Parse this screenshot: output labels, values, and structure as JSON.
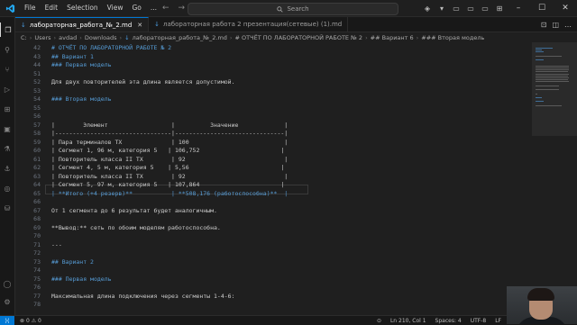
{
  "titlebar": {
    "menu": [
      "File",
      "Edit",
      "Selection",
      "View",
      "Go",
      "..."
    ],
    "search_placeholder": "Search"
  },
  "tabs": [
    {
      "label": "лабораторная_работа_№_2.md",
      "active": true
    },
    {
      "label": "лабораторная работа 2 презентация(сетевые) (1).md",
      "active": false
    }
  ],
  "breadcrumb": [
    "C:",
    "Users",
    "avdad",
    "Downloads",
    "лабораторная_работа_№_2.md",
    "# ОТЧЁТ ПО ЛАБОРАТОРНОЙ РАБОТЕ № 2",
    "## Вариант 6",
    "### Вторая модель"
  ],
  "editor": {
    "lines": [
      {
        "n": "42",
        "text": "# ОТЧЁТ ПО ЛАБОРАТОРНОЙ РАБОТЕ № 2",
        "style": "heading"
      },
      {
        "n": "43",
        "text": "## Вариант 1",
        "style": "heading"
      },
      {
        "n": "44",
        "text": "### Первая модель",
        "style": "heading"
      },
      {
        "n": "51",
        "text": "",
        "style": ""
      },
      {
        "n": "52",
        "text": "Для двух повторителей эта длина является допустимой.",
        "style": ""
      },
      {
        "n": "53",
        "text": "",
        "style": ""
      },
      {
        "n": "54",
        "text": "### Вторая модель",
        "style": "heading"
      },
      {
        "n": "55",
        "text": "",
        "style": ""
      },
      {
        "n": "56",
        "text": "",
        "style": ""
      },
      {
        "n": "57",
        "text": "|        Элемент                  |          Значение             |",
        "style": ""
      },
      {
        "n": "58",
        "text": "|---------------------------------|-------------------------------|",
        "style": ""
      },
      {
        "n": "59",
        "text": "| Пара терминалов ТХ              | 100                           |",
        "style": ""
      },
      {
        "n": "60",
        "text": "| Сегмент 1, 96 м, категория 5   | 106,752                       |",
        "style": ""
      },
      {
        "n": "61",
        "text": "| Повторитель класса II TX        | 92                            |",
        "style": ""
      },
      {
        "n": "62",
        "text": "| Сегмент 4, 5 м, категория 5    | 5,56                          |",
        "style": ""
      },
      {
        "n": "63",
        "text": "| Повторитель класса II TX        | 92                            |",
        "style": ""
      },
      {
        "n": "64",
        "text": "| Сегмент 5, 97 м, категория 5   | 107,864                       |",
        "style": ""
      },
      {
        "n": "65",
        "text": "| **Итого (+4 резерв)**           | **508,176 (работоспособна)**  |",
        "style": "bold"
      },
      {
        "n": "66",
        "text": "",
        "style": ""
      },
      {
        "n": "67",
        "text": "От 1 сегмента до 6 результат будет аналогичным.",
        "style": ""
      },
      {
        "n": "68",
        "text": "",
        "style": ""
      },
      {
        "n": "69",
        "text": "**Вывод:** сеть по обоим моделям работоспособна.",
        "style": "mixed"
      },
      {
        "n": "70",
        "text": "",
        "style": ""
      },
      {
        "n": "71",
        "text": "---",
        "style": ""
      },
      {
        "n": "72",
        "text": "",
        "style": ""
      },
      {
        "n": "73",
        "text": "## Вариант 2",
        "style": "heading"
      },
      {
        "n": "74",
        "text": "",
        "style": ""
      },
      {
        "n": "75",
        "text": "### Первая модель",
        "style": "heading"
      },
      {
        "n": "76",
        "text": "",
        "style": ""
      },
      {
        "n": "77",
        "text": "Максимальная длина подключения через сегменты 1-4-6:",
        "style": ""
      },
      {
        "n": "78",
        "text": "",
        "style": ""
      }
    ]
  },
  "statusbar": {
    "errors": "0",
    "warnings": "0",
    "position": "Ln 210, Col 1",
    "spaces": "Spaces: 4",
    "encoding": "UTF-8",
    "eol": "LF"
  },
  "colors": {
    "accent": "#0078d4",
    "heading": "#569cd6"
  }
}
